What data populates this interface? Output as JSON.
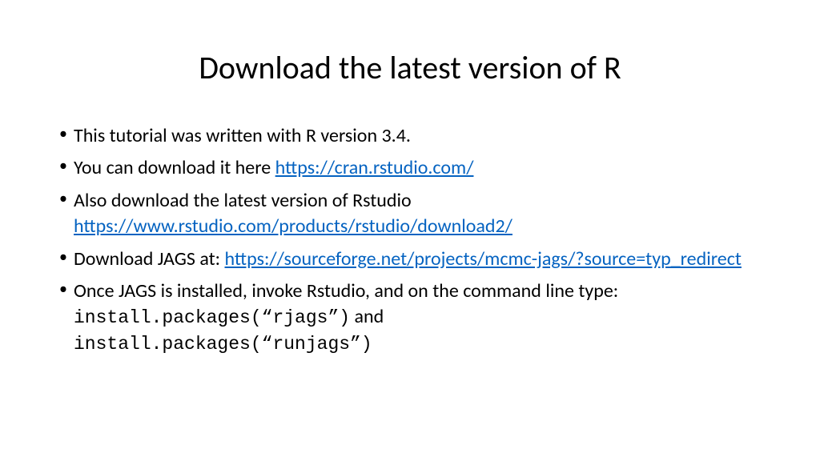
{
  "title": "Download the latest version of R",
  "bullets": {
    "b1": "This tutorial was written with R version 3.4.",
    "b2_prefix": "You can download it here ",
    "b2_link": "https://cran.rstudio.com/",
    "b3_prefix": "Also download the latest version of Rstudio ",
    "b3_link": "https://www.rstudio.com/products/rstudio/download2/",
    "b4_prefix": "Download JAGS at: ",
    "b4_link": "https://sourceforge.net/projects/mcmc-jags/?source=typ_redirect",
    "b5_prefix": "Once JAGS is installed, invoke Rstudio, and on the command line type: ",
    "b5_code1": "install.packages(“rjags”)",
    "b5_and": " and ",
    "b5_code2": "install.packages(“runjags”)"
  }
}
